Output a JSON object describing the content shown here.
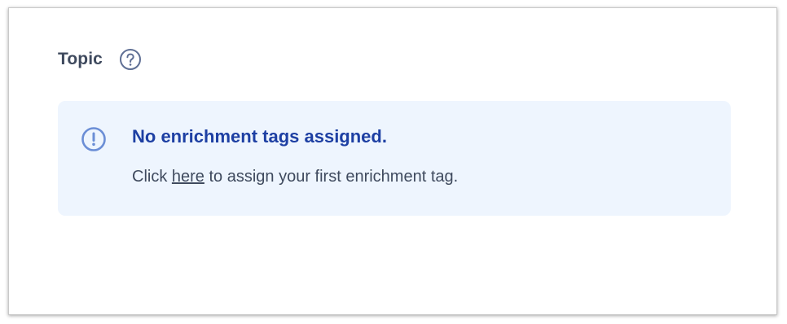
{
  "section": {
    "title": "Topic",
    "help_icon": "question-circle-icon"
  },
  "notice": {
    "icon": "exclamation-circle-icon",
    "title": "No enrichment tags assigned.",
    "body_prefix": "Click ",
    "link_text": "here",
    "body_suffix": " to assign your first enrichment tag.",
    "colors": {
      "background": "#eef5fe",
      "title": "#1d3fa3",
      "icon": "#6b8ed6",
      "text": "#3f4a5e"
    }
  }
}
